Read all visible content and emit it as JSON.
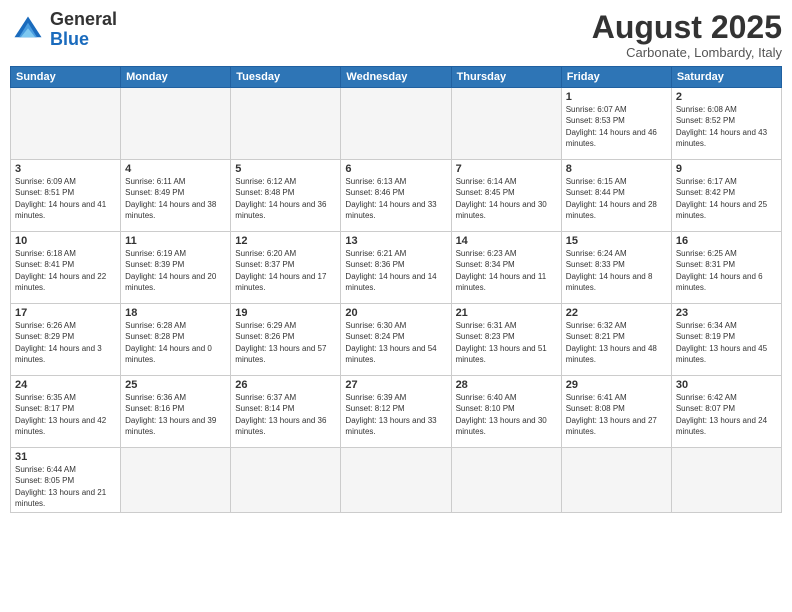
{
  "logo": {
    "general": "General",
    "blue": "Blue"
  },
  "title": "August 2025",
  "subtitle": "Carbonate, Lombardy, Italy",
  "weekdays": [
    "Sunday",
    "Monday",
    "Tuesday",
    "Wednesday",
    "Thursday",
    "Friday",
    "Saturday"
  ],
  "weeks": [
    [
      {
        "day": "",
        "info": ""
      },
      {
        "day": "",
        "info": ""
      },
      {
        "day": "",
        "info": ""
      },
      {
        "day": "",
        "info": ""
      },
      {
        "day": "",
        "info": ""
      },
      {
        "day": "1",
        "info": "Sunrise: 6:07 AM\nSunset: 8:53 PM\nDaylight: 14 hours and 46 minutes."
      },
      {
        "day": "2",
        "info": "Sunrise: 6:08 AM\nSunset: 8:52 PM\nDaylight: 14 hours and 43 minutes."
      }
    ],
    [
      {
        "day": "3",
        "info": "Sunrise: 6:09 AM\nSunset: 8:51 PM\nDaylight: 14 hours and 41 minutes."
      },
      {
        "day": "4",
        "info": "Sunrise: 6:11 AM\nSunset: 8:49 PM\nDaylight: 14 hours and 38 minutes."
      },
      {
        "day": "5",
        "info": "Sunrise: 6:12 AM\nSunset: 8:48 PM\nDaylight: 14 hours and 36 minutes."
      },
      {
        "day": "6",
        "info": "Sunrise: 6:13 AM\nSunset: 8:46 PM\nDaylight: 14 hours and 33 minutes."
      },
      {
        "day": "7",
        "info": "Sunrise: 6:14 AM\nSunset: 8:45 PM\nDaylight: 14 hours and 30 minutes."
      },
      {
        "day": "8",
        "info": "Sunrise: 6:15 AM\nSunset: 8:44 PM\nDaylight: 14 hours and 28 minutes."
      },
      {
        "day": "9",
        "info": "Sunrise: 6:17 AM\nSunset: 8:42 PM\nDaylight: 14 hours and 25 minutes."
      }
    ],
    [
      {
        "day": "10",
        "info": "Sunrise: 6:18 AM\nSunset: 8:41 PM\nDaylight: 14 hours and 22 minutes."
      },
      {
        "day": "11",
        "info": "Sunrise: 6:19 AM\nSunset: 8:39 PM\nDaylight: 14 hours and 20 minutes."
      },
      {
        "day": "12",
        "info": "Sunrise: 6:20 AM\nSunset: 8:37 PM\nDaylight: 14 hours and 17 minutes."
      },
      {
        "day": "13",
        "info": "Sunrise: 6:21 AM\nSunset: 8:36 PM\nDaylight: 14 hours and 14 minutes."
      },
      {
        "day": "14",
        "info": "Sunrise: 6:23 AM\nSunset: 8:34 PM\nDaylight: 14 hours and 11 minutes."
      },
      {
        "day": "15",
        "info": "Sunrise: 6:24 AM\nSunset: 8:33 PM\nDaylight: 14 hours and 8 minutes."
      },
      {
        "day": "16",
        "info": "Sunrise: 6:25 AM\nSunset: 8:31 PM\nDaylight: 14 hours and 6 minutes."
      }
    ],
    [
      {
        "day": "17",
        "info": "Sunrise: 6:26 AM\nSunset: 8:29 PM\nDaylight: 14 hours and 3 minutes."
      },
      {
        "day": "18",
        "info": "Sunrise: 6:28 AM\nSunset: 8:28 PM\nDaylight: 14 hours and 0 minutes."
      },
      {
        "day": "19",
        "info": "Sunrise: 6:29 AM\nSunset: 8:26 PM\nDaylight: 13 hours and 57 minutes."
      },
      {
        "day": "20",
        "info": "Sunrise: 6:30 AM\nSunset: 8:24 PM\nDaylight: 13 hours and 54 minutes."
      },
      {
        "day": "21",
        "info": "Sunrise: 6:31 AM\nSunset: 8:23 PM\nDaylight: 13 hours and 51 minutes."
      },
      {
        "day": "22",
        "info": "Sunrise: 6:32 AM\nSunset: 8:21 PM\nDaylight: 13 hours and 48 minutes."
      },
      {
        "day": "23",
        "info": "Sunrise: 6:34 AM\nSunset: 8:19 PM\nDaylight: 13 hours and 45 minutes."
      }
    ],
    [
      {
        "day": "24",
        "info": "Sunrise: 6:35 AM\nSunset: 8:17 PM\nDaylight: 13 hours and 42 minutes."
      },
      {
        "day": "25",
        "info": "Sunrise: 6:36 AM\nSunset: 8:16 PM\nDaylight: 13 hours and 39 minutes."
      },
      {
        "day": "26",
        "info": "Sunrise: 6:37 AM\nSunset: 8:14 PM\nDaylight: 13 hours and 36 minutes."
      },
      {
        "day": "27",
        "info": "Sunrise: 6:39 AM\nSunset: 8:12 PM\nDaylight: 13 hours and 33 minutes."
      },
      {
        "day": "28",
        "info": "Sunrise: 6:40 AM\nSunset: 8:10 PM\nDaylight: 13 hours and 30 minutes."
      },
      {
        "day": "29",
        "info": "Sunrise: 6:41 AM\nSunset: 8:08 PM\nDaylight: 13 hours and 27 minutes."
      },
      {
        "day": "30",
        "info": "Sunrise: 6:42 AM\nSunset: 8:07 PM\nDaylight: 13 hours and 24 minutes."
      }
    ],
    [
      {
        "day": "31",
        "info": "Sunrise: 6:44 AM\nSunset: 8:05 PM\nDaylight: 13 hours and 21 minutes."
      },
      {
        "day": "",
        "info": ""
      },
      {
        "day": "",
        "info": ""
      },
      {
        "day": "",
        "info": ""
      },
      {
        "day": "",
        "info": ""
      },
      {
        "day": "",
        "info": ""
      },
      {
        "day": "",
        "info": ""
      }
    ]
  ]
}
